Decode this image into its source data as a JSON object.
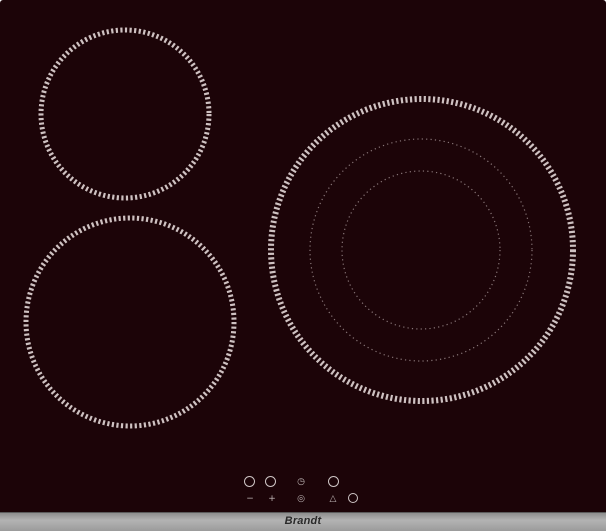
{
  "brand": {
    "name": "Brandt"
  },
  "colors": {
    "glass": "#1c0408",
    "zone_marking": "#e2d6d6",
    "trim": "#a3a3a3"
  },
  "cooking_zones": [
    {
      "id": "rear-left",
      "rings": 1
    },
    {
      "id": "front-left",
      "rings": 1
    },
    {
      "id": "right-triple",
      "rings": 3
    }
  ],
  "controls": {
    "top_row": [
      "select-zone-button",
      "select-zone-button",
      "timer-icon",
      "power-button"
    ],
    "bottom_row": [
      "minus-icon",
      "plus-icon",
      "zone-select-icon",
      "lock-icon",
      "power-icon"
    ]
  }
}
